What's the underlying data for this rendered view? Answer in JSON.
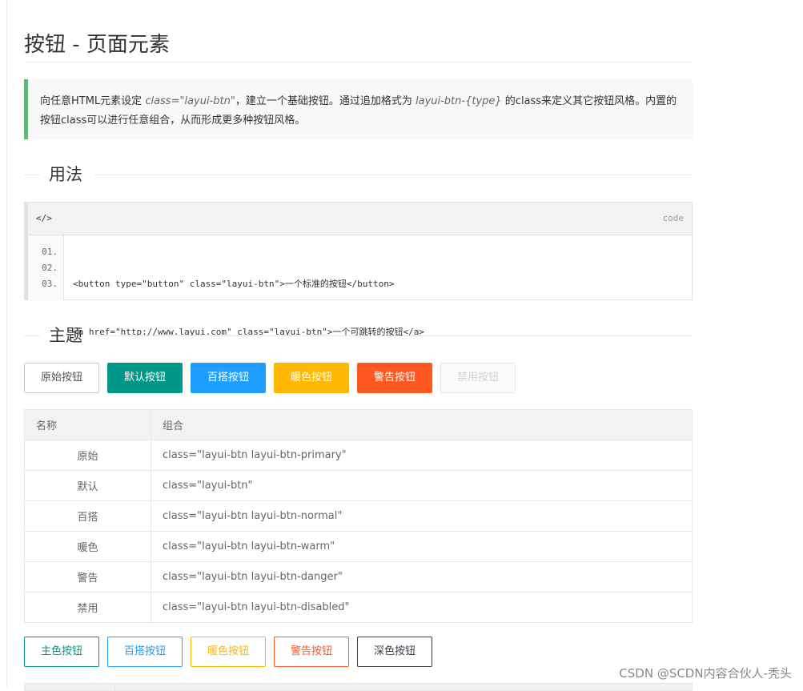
{
  "page": {
    "title": "按钮 - 页面元素",
    "intro": {
      "part1": "向任意HTML元素设定 ",
      "code1": "class=\"layui-btn\"",
      "part2": "，建立一个基础按钮。通过追加格式为 ",
      "code2": "layui-btn-{type}",
      "part3": " 的class来定义其它按钮风格。内置的按钮class可以进行任意组合，从而形成更多种按钮风格。"
    }
  },
  "usage": {
    "heading": "用法",
    "code_tag": "</>",
    "code_lang": "code",
    "line_numbers": [
      "01.",
      "02.",
      "03."
    ],
    "lines": [
      "<button type=\"button\" class=\"layui-btn\">一个标准的按钮</button>",
      "<a href=\"http://www.layui.com\" class=\"layui-btn\">一个可跳转的按钮</a>",
      ""
    ]
  },
  "theme": {
    "heading": "主题",
    "buttons": [
      "原始按钮",
      "默认按钮",
      "百搭按钮",
      "暖色按钮",
      "警告按钮",
      "禁用按钮"
    ],
    "table": {
      "headers": [
        "名称",
        "组合"
      ],
      "rows": [
        [
          "原始",
          "class=\"layui-btn layui-btn-primary\""
        ],
        [
          "默认",
          "class=\"layui-btn\""
        ],
        [
          "百搭",
          "class=\"layui-btn layui-btn-normal\""
        ],
        [
          "暖色",
          "class=\"layui-btn layui-btn-warm\""
        ],
        [
          "警告",
          "class=\"layui-btn layui-btn-danger\""
        ],
        [
          "禁用",
          "class=\"layui-btn layui-btn-disabled\""
        ]
      ]
    },
    "outline_buttons": [
      "主色按钮",
      "百搭按钮",
      "暖色按钮",
      "警告按钮",
      "深色按钮"
    ]
  },
  "colors": {
    "accent_green": "#009688",
    "normal_blue": "#1e9fff",
    "warm_yellow": "#ffb800",
    "danger_orange": "#ff5722",
    "dark": "#393d49",
    "quote_border": "#5fb878"
  },
  "watermark": "CSDN @SCDN内容合伙人-秃头"
}
